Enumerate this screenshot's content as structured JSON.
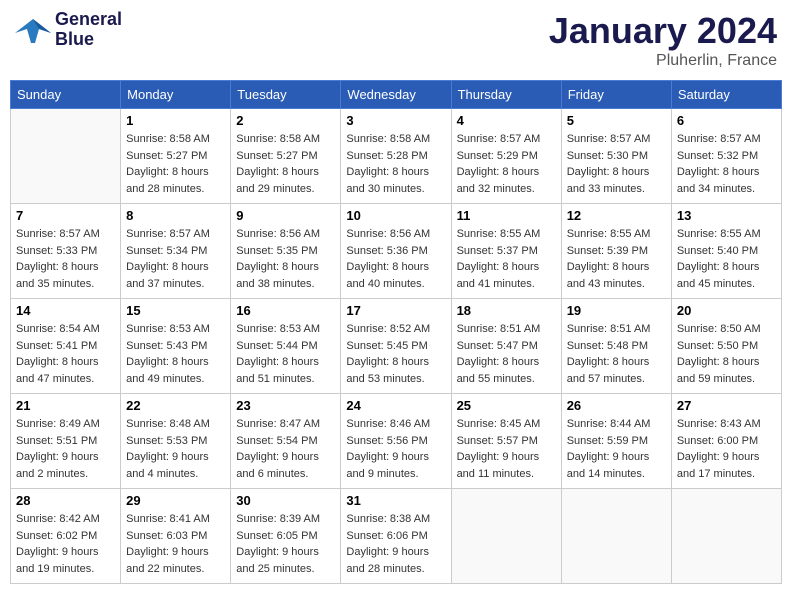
{
  "header": {
    "logo_line1": "General",
    "logo_line2": "Blue",
    "month": "January 2024",
    "location": "Pluherlin, France"
  },
  "weekdays": [
    "Sunday",
    "Monday",
    "Tuesday",
    "Wednesday",
    "Thursday",
    "Friday",
    "Saturday"
  ],
  "weeks": [
    [
      {
        "day": "",
        "sunrise": "",
        "sunset": "",
        "daylight": ""
      },
      {
        "day": "1",
        "sunrise": "Sunrise: 8:58 AM",
        "sunset": "Sunset: 5:27 PM",
        "daylight": "Daylight: 8 hours and 28 minutes."
      },
      {
        "day": "2",
        "sunrise": "Sunrise: 8:58 AM",
        "sunset": "Sunset: 5:27 PM",
        "daylight": "Daylight: 8 hours and 29 minutes."
      },
      {
        "day": "3",
        "sunrise": "Sunrise: 8:58 AM",
        "sunset": "Sunset: 5:28 PM",
        "daylight": "Daylight: 8 hours and 30 minutes."
      },
      {
        "day": "4",
        "sunrise": "Sunrise: 8:57 AM",
        "sunset": "Sunset: 5:29 PM",
        "daylight": "Daylight: 8 hours and 32 minutes."
      },
      {
        "day": "5",
        "sunrise": "Sunrise: 8:57 AM",
        "sunset": "Sunset: 5:30 PM",
        "daylight": "Daylight: 8 hours and 33 minutes."
      },
      {
        "day": "6",
        "sunrise": "Sunrise: 8:57 AM",
        "sunset": "Sunset: 5:32 PM",
        "daylight": "Daylight: 8 hours and 34 minutes."
      }
    ],
    [
      {
        "day": "7",
        "sunrise": "Sunrise: 8:57 AM",
        "sunset": "Sunset: 5:33 PM",
        "daylight": "Daylight: 8 hours and 35 minutes."
      },
      {
        "day": "8",
        "sunrise": "Sunrise: 8:57 AM",
        "sunset": "Sunset: 5:34 PM",
        "daylight": "Daylight: 8 hours and 37 minutes."
      },
      {
        "day": "9",
        "sunrise": "Sunrise: 8:56 AM",
        "sunset": "Sunset: 5:35 PM",
        "daylight": "Daylight: 8 hours and 38 minutes."
      },
      {
        "day": "10",
        "sunrise": "Sunrise: 8:56 AM",
        "sunset": "Sunset: 5:36 PM",
        "daylight": "Daylight: 8 hours and 40 minutes."
      },
      {
        "day": "11",
        "sunrise": "Sunrise: 8:55 AM",
        "sunset": "Sunset: 5:37 PM",
        "daylight": "Daylight: 8 hours and 41 minutes."
      },
      {
        "day": "12",
        "sunrise": "Sunrise: 8:55 AM",
        "sunset": "Sunset: 5:39 PM",
        "daylight": "Daylight: 8 hours and 43 minutes."
      },
      {
        "day": "13",
        "sunrise": "Sunrise: 8:55 AM",
        "sunset": "Sunset: 5:40 PM",
        "daylight": "Daylight: 8 hours and 45 minutes."
      }
    ],
    [
      {
        "day": "14",
        "sunrise": "Sunrise: 8:54 AM",
        "sunset": "Sunset: 5:41 PM",
        "daylight": "Daylight: 8 hours and 47 minutes."
      },
      {
        "day": "15",
        "sunrise": "Sunrise: 8:53 AM",
        "sunset": "Sunset: 5:43 PM",
        "daylight": "Daylight: 8 hours and 49 minutes."
      },
      {
        "day": "16",
        "sunrise": "Sunrise: 8:53 AM",
        "sunset": "Sunset: 5:44 PM",
        "daylight": "Daylight: 8 hours and 51 minutes."
      },
      {
        "day": "17",
        "sunrise": "Sunrise: 8:52 AM",
        "sunset": "Sunset: 5:45 PM",
        "daylight": "Daylight: 8 hours and 53 minutes."
      },
      {
        "day": "18",
        "sunrise": "Sunrise: 8:51 AM",
        "sunset": "Sunset: 5:47 PM",
        "daylight": "Daylight: 8 hours and 55 minutes."
      },
      {
        "day": "19",
        "sunrise": "Sunrise: 8:51 AM",
        "sunset": "Sunset: 5:48 PM",
        "daylight": "Daylight: 8 hours and 57 minutes."
      },
      {
        "day": "20",
        "sunrise": "Sunrise: 8:50 AM",
        "sunset": "Sunset: 5:50 PM",
        "daylight": "Daylight: 8 hours and 59 minutes."
      }
    ],
    [
      {
        "day": "21",
        "sunrise": "Sunrise: 8:49 AM",
        "sunset": "Sunset: 5:51 PM",
        "daylight": "Daylight: 9 hours and 2 minutes."
      },
      {
        "day": "22",
        "sunrise": "Sunrise: 8:48 AM",
        "sunset": "Sunset: 5:53 PM",
        "daylight": "Daylight: 9 hours and 4 minutes."
      },
      {
        "day": "23",
        "sunrise": "Sunrise: 8:47 AM",
        "sunset": "Sunset: 5:54 PM",
        "daylight": "Daylight: 9 hours and 6 minutes."
      },
      {
        "day": "24",
        "sunrise": "Sunrise: 8:46 AM",
        "sunset": "Sunset: 5:56 PM",
        "daylight": "Daylight: 9 hours and 9 minutes."
      },
      {
        "day": "25",
        "sunrise": "Sunrise: 8:45 AM",
        "sunset": "Sunset: 5:57 PM",
        "daylight": "Daylight: 9 hours and 11 minutes."
      },
      {
        "day": "26",
        "sunrise": "Sunrise: 8:44 AM",
        "sunset": "Sunset: 5:59 PM",
        "daylight": "Daylight: 9 hours and 14 minutes."
      },
      {
        "day": "27",
        "sunrise": "Sunrise: 8:43 AM",
        "sunset": "Sunset: 6:00 PM",
        "daylight": "Daylight: 9 hours and 17 minutes."
      }
    ],
    [
      {
        "day": "28",
        "sunrise": "Sunrise: 8:42 AM",
        "sunset": "Sunset: 6:02 PM",
        "daylight": "Daylight: 9 hours and 19 minutes."
      },
      {
        "day": "29",
        "sunrise": "Sunrise: 8:41 AM",
        "sunset": "Sunset: 6:03 PM",
        "daylight": "Daylight: 9 hours and 22 minutes."
      },
      {
        "day": "30",
        "sunrise": "Sunrise: 8:39 AM",
        "sunset": "Sunset: 6:05 PM",
        "daylight": "Daylight: 9 hours and 25 minutes."
      },
      {
        "day": "31",
        "sunrise": "Sunrise: 8:38 AM",
        "sunset": "Sunset: 6:06 PM",
        "daylight": "Daylight: 9 hours and 28 minutes."
      },
      {
        "day": "",
        "sunrise": "",
        "sunset": "",
        "daylight": ""
      },
      {
        "day": "",
        "sunrise": "",
        "sunset": "",
        "daylight": ""
      },
      {
        "day": "",
        "sunrise": "",
        "sunset": "",
        "daylight": ""
      }
    ]
  ]
}
